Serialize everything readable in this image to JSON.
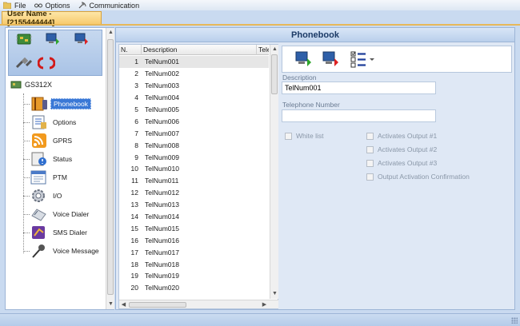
{
  "menu": [
    {
      "label": "File",
      "icon": "folder-icon"
    },
    {
      "label": "Options",
      "icon": "glasses-icon"
    },
    {
      "label": "Communication",
      "icon": "satellite-icon"
    }
  ],
  "user_tab": {
    "label": "User Name - [2155444444]"
  },
  "tree": {
    "root": {
      "label": "GS312X",
      "icon": "device-icon"
    },
    "items": [
      {
        "label": "Phonebook",
        "icon": "phonebook-icon",
        "selected": true
      },
      {
        "label": "Options",
        "icon": "options-icon"
      },
      {
        "label": "GPRS",
        "icon": "rss-icon"
      },
      {
        "label": "Status",
        "icon": "status-icon"
      },
      {
        "label": "PTM",
        "icon": "ptm-icon"
      },
      {
        "label": "I/O",
        "icon": "io-gear-icon"
      },
      {
        "label": "Voice Dialer",
        "icon": "phone-icon"
      },
      {
        "label": "SMS Dialer",
        "icon": "sms-icon"
      },
      {
        "label": "Voice Message",
        "icon": "microphone-icon"
      }
    ]
  },
  "main": {
    "title": "Phonebook"
  },
  "grid": {
    "columns": [
      "N.",
      "Description",
      "Tele"
    ],
    "rows": [
      {
        "n": "1",
        "d": "TelNum001"
      },
      {
        "n": "2",
        "d": "TelNum002"
      },
      {
        "n": "3",
        "d": "TelNum003"
      },
      {
        "n": "4",
        "d": "TelNum004"
      },
      {
        "n": "5",
        "d": "TelNum005"
      },
      {
        "n": "6",
        "d": "TelNum006"
      },
      {
        "n": "7",
        "d": "TelNum007"
      },
      {
        "n": "8",
        "d": "TelNum008"
      },
      {
        "n": "9",
        "d": "TelNum009"
      },
      {
        "n": "10",
        "d": "TelNum010"
      },
      {
        "n": "11",
        "d": "TelNum011"
      },
      {
        "n": "12",
        "d": "TelNum012"
      },
      {
        "n": "13",
        "d": "TelNum013"
      },
      {
        "n": "14",
        "d": "TelNum014"
      },
      {
        "n": "15",
        "d": "TelNum015"
      },
      {
        "n": "16",
        "d": "TelNum016"
      },
      {
        "n": "17",
        "d": "TelNum017"
      },
      {
        "n": "18",
        "d": "TelNum018"
      },
      {
        "n": "19",
        "d": "TelNum019"
      },
      {
        "n": "20",
        "d": "TelNum020"
      }
    ]
  },
  "form": {
    "description_label": "Description",
    "description_value": "TelNum001",
    "telephone_label": "Telephone Number",
    "telephone_value": "",
    "white_list": "White list",
    "out1": "Activates Output #1",
    "out2": "Activates Output #2",
    "out3": "Activates Output #3",
    "confirm": "Output Activation Confirmation"
  },
  "colors": {
    "accent": "#3a78d6",
    "header_text": "#1b3a66",
    "tab": "#f7c96a"
  }
}
